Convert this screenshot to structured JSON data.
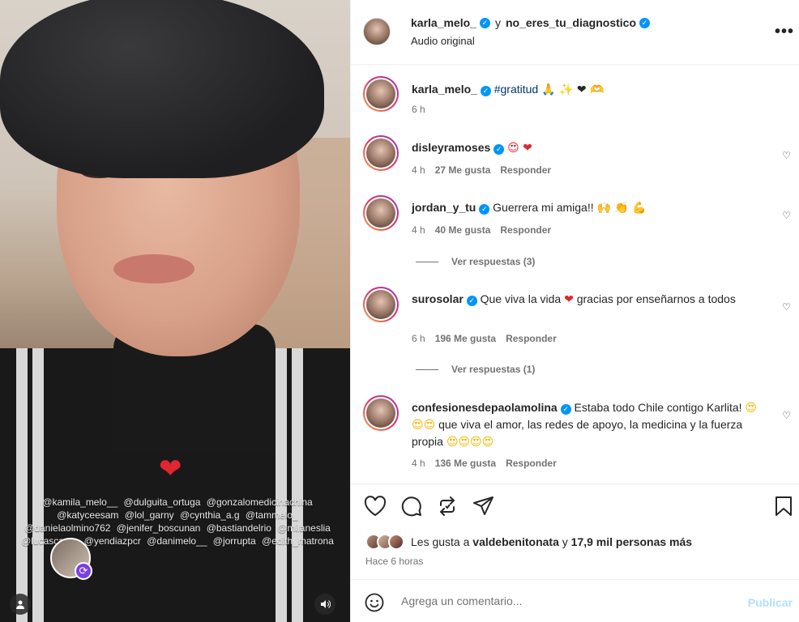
{
  "header": {
    "author": "karla_melo_",
    "conjunction": "y",
    "collaborator": "no_eres_tu_diagnostico",
    "audio": "Audio original",
    "more_icon": "more-horizontal-icon"
  },
  "caption": {
    "user": "karla_melo_",
    "hashtag": "#gratitud",
    "emoji": "🙏 ✨ ❤ 🫶",
    "time": "6 h"
  },
  "comments": [
    {
      "user": "disleyramoses",
      "text": "",
      "emoji": "😍 ❤",
      "time": "4 h",
      "likes": "27 Me gusta",
      "reply": "Responder"
    },
    {
      "user": "jordan_y_tu",
      "text": "Guerrera mi amiga!! ",
      "emoji": "🙌 👏 💪",
      "time": "4 h",
      "likes": "40 Me gusta",
      "reply": "Responder",
      "replies": "Ver respuestas (3)"
    },
    {
      "user": "surosolar",
      "text": "Que viva la vida ",
      "heart": "❤",
      "text2": " gracias por enseñarnos a todos",
      "time": "6 h",
      "likes": "196 Me gusta",
      "reply": "Responder",
      "replies": "Ver respuestas (1)"
    },
    {
      "user": "confesionesdepaolamolina",
      "text": "Estaba todo Chile contigo Karlita! ",
      "emoji1": "😍😍😍",
      "text2": " que viva el amor, las redes de apoyo, la medicina y la fuerza propia ",
      "emoji2": "😍😍😍😍",
      "time": "4 h",
      "likes": "136 Me gusta",
      "reply": "Responder"
    }
  ],
  "likes_bar": {
    "prefix": "Les gusta a ",
    "user": "valdebenitonata",
    "middle": " y ",
    "count": "17,9 mil personas más",
    "time": "Hace 6 horas"
  },
  "composer": {
    "placeholder": "Agrega un comentario...",
    "post": "Publicar"
  },
  "media": {
    "sticker": "❤",
    "tags": [
      "@kamila_melo__",
      "@dulguita_ortuga",
      "@gonzalomedicinachina",
      "@katyceesam",
      "@lol_garny",
      "@cynthia_a.g",
      "@tammelo_",
      "@danielaolmino762",
      "@jenifer_boscunan",
      "@bastiandelrio",
      "@milaneslia",
      "@lucascaroo",
      "@yendiazpcr",
      "@danimelo__",
      "@jorrupta",
      "@edith_matrona"
    ]
  },
  "colors": {
    "verified": "#0095f6",
    "link": "#00376b",
    "muted": "#737373",
    "post": "#b2dffc"
  }
}
